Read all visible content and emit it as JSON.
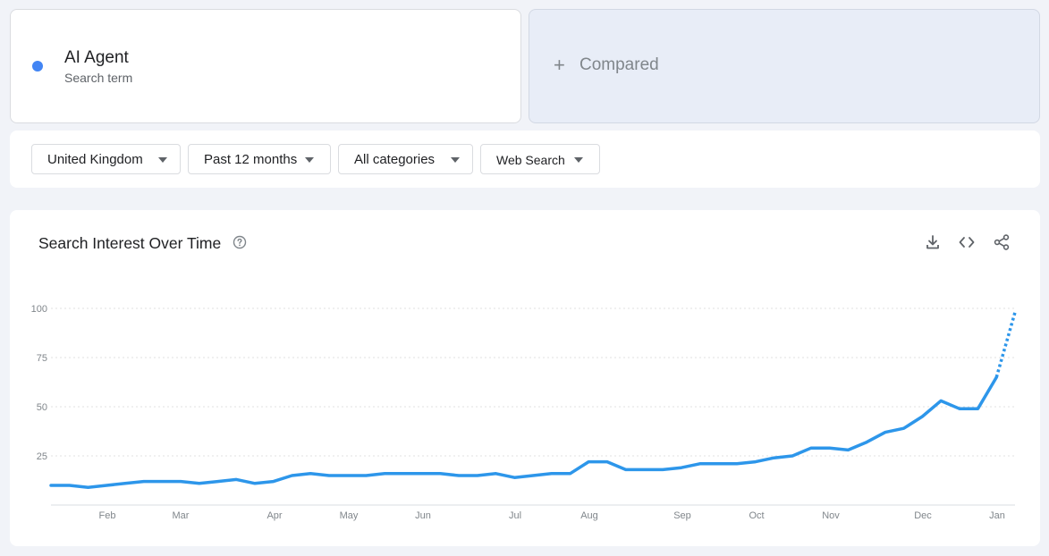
{
  "search_term": {
    "name": "AI Agent",
    "subtitle": "Search term",
    "color": "#4285f4"
  },
  "compare": {
    "label": "Compared",
    "plus": "+"
  },
  "filters": [
    {
      "label": "United Kingdom"
    },
    {
      "label": "Past 12 months"
    },
    {
      "label": "All categories"
    },
    {
      "label": "Web Search"
    }
  ],
  "chart_panel": {
    "title": "Search Interest Over Time",
    "icons": [
      "help-icon",
      "download-icon",
      "embed-code-icon",
      "share-icon"
    ]
  },
  "chart_data": {
    "type": "line",
    "y_ticks": [
      25,
      50,
      75,
      100
    ],
    "ylim": [
      0,
      100
    ],
    "grid": true,
    "x_tick_labels": [
      "Feb",
      "Mar",
      "Apr",
      "May",
      "Jun",
      "Jul",
      "Aug",
      "Sep",
      "Oct",
      "Nov",
      "Dec",
      "Jan"
    ],
    "series": [
      {
        "color": "#2d96ea",
        "values": [
          10,
          10,
          9,
          10,
          11,
          12,
          12,
          12,
          11,
          12,
          13,
          11,
          12,
          15,
          16,
          15,
          15,
          15,
          16,
          16,
          16,
          16,
          15,
          15,
          16,
          14,
          15,
          16,
          16,
          22,
          22,
          18,
          18,
          18,
          19,
          21,
          21,
          21,
          22,
          24,
          25,
          29,
          29,
          28,
          32,
          37,
          39,
          45,
          53,
          49,
          49,
          65
        ],
        "partial_last_value": 98
      }
    ]
  }
}
